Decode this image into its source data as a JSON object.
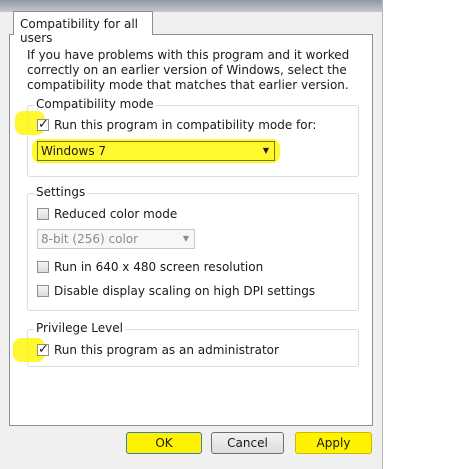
{
  "tab": {
    "label": "Compatibility for all users"
  },
  "intro": "If you have problems with this program and it worked correctly on an earlier version of Windows, select the compatibility mode that matches that earlier version.",
  "compat": {
    "legend": "Compatibility mode",
    "run_in_compat": {
      "label": "Run this program in compatibility mode for:",
      "checked": true
    },
    "os_select": {
      "value": "Windows 7"
    }
  },
  "settings": {
    "legend": "Settings",
    "reduced_color": {
      "label": "Reduced color mode",
      "checked": false
    },
    "color_select": {
      "value": "8-bit (256) color"
    },
    "res_640": {
      "label": "Run in 640 x 480 screen resolution",
      "checked": false
    },
    "dpi_scaling": {
      "label": "Disable display scaling on high DPI settings",
      "checked": false
    }
  },
  "privilege": {
    "legend": "Privilege Level",
    "run_admin": {
      "label": "Run this program as an administrator",
      "checked": true
    }
  },
  "buttons": {
    "ok": "OK",
    "cancel": "Cancel",
    "apply": "Apply"
  },
  "colors": {
    "highlight": "#fff200",
    "panel": "#ffffff",
    "frame": "#f0f0f0"
  }
}
